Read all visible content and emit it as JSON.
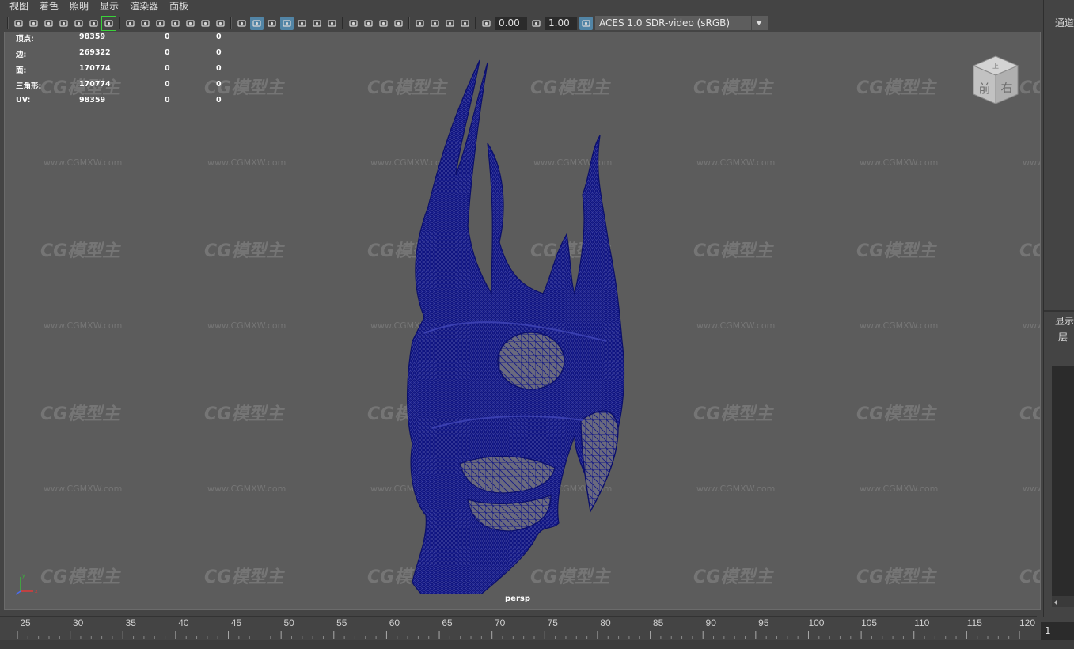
{
  "menu": [
    "视图",
    "着色",
    "照明",
    "显示",
    "渲染器",
    "面板"
  ],
  "toolbar": {
    "icons_group1": [
      "camera-icon",
      "camera-attributes-icon",
      "camera-lock-icon",
      "bookmark-icon",
      "image-plane-icon",
      "film-gate-icon",
      "pencil-icon"
    ],
    "icons_group2": [
      "grid-icon",
      "resolution-gate-icon",
      "gate-mask-icon",
      "field-chart-icon",
      "safe-action-icon",
      "safe-title-icon",
      "text-icon"
    ],
    "icons_group3": [
      "wireframe-icon",
      "smooth-shade-icon",
      "default-material-icon",
      "wireframe-on-shaded-icon",
      "textured-icon",
      "lights-icon",
      "shadows-icon"
    ],
    "icons_group4": [
      "ambient-occlusion-icon",
      "motion-blur-icon",
      "anti-alias-icon",
      "depth-of-field-icon"
    ],
    "icons_group5": [
      "isolate-select-icon",
      "xray-icon",
      "xray-joints-icon",
      "backface-icon"
    ],
    "exposure_value": "0.00",
    "gamma_value": "1.00",
    "colorspace_label": "ACES 1.0 SDR-video (sRGB)"
  },
  "hud": {
    "rows": [
      {
        "label": "顶点:",
        "v1": "98359",
        "v2": "0",
        "v3": "0"
      },
      {
        "label": "边:",
        "v1": "269322",
        "v2": "0",
        "v3": "0"
      },
      {
        "label": "面:",
        "v1": "170774",
        "v2": "0",
        "v3": "0"
      },
      {
        "label": "三角形:",
        "v1": "170774",
        "v2": "0",
        "v3": "0"
      },
      {
        "label": "UV:",
        "v1": "98359",
        "v2": "0",
        "v3": "0"
      }
    ]
  },
  "viewcube": {
    "top": "上",
    "front": "前",
    "right": "右"
  },
  "viewport": {
    "camera_label": "persp",
    "model_color": "#0f1480",
    "background_color": "#5c5c5c"
  },
  "watermark": {
    "logo_text": "CG模型主",
    "url_text": "www.CGMXW.com"
  },
  "right_panel": {
    "channels_label": "通道",
    "display_tab": "显示",
    "layer_label": "层"
  },
  "timeline": {
    "ticks": [
      "25",
      "30",
      "35",
      "40",
      "45",
      "50",
      "55",
      "60",
      "65",
      "70",
      "75",
      "80",
      "85",
      "90",
      "95",
      "100",
      "105",
      "110",
      "115",
      "120"
    ],
    "current_frame": "1"
  }
}
